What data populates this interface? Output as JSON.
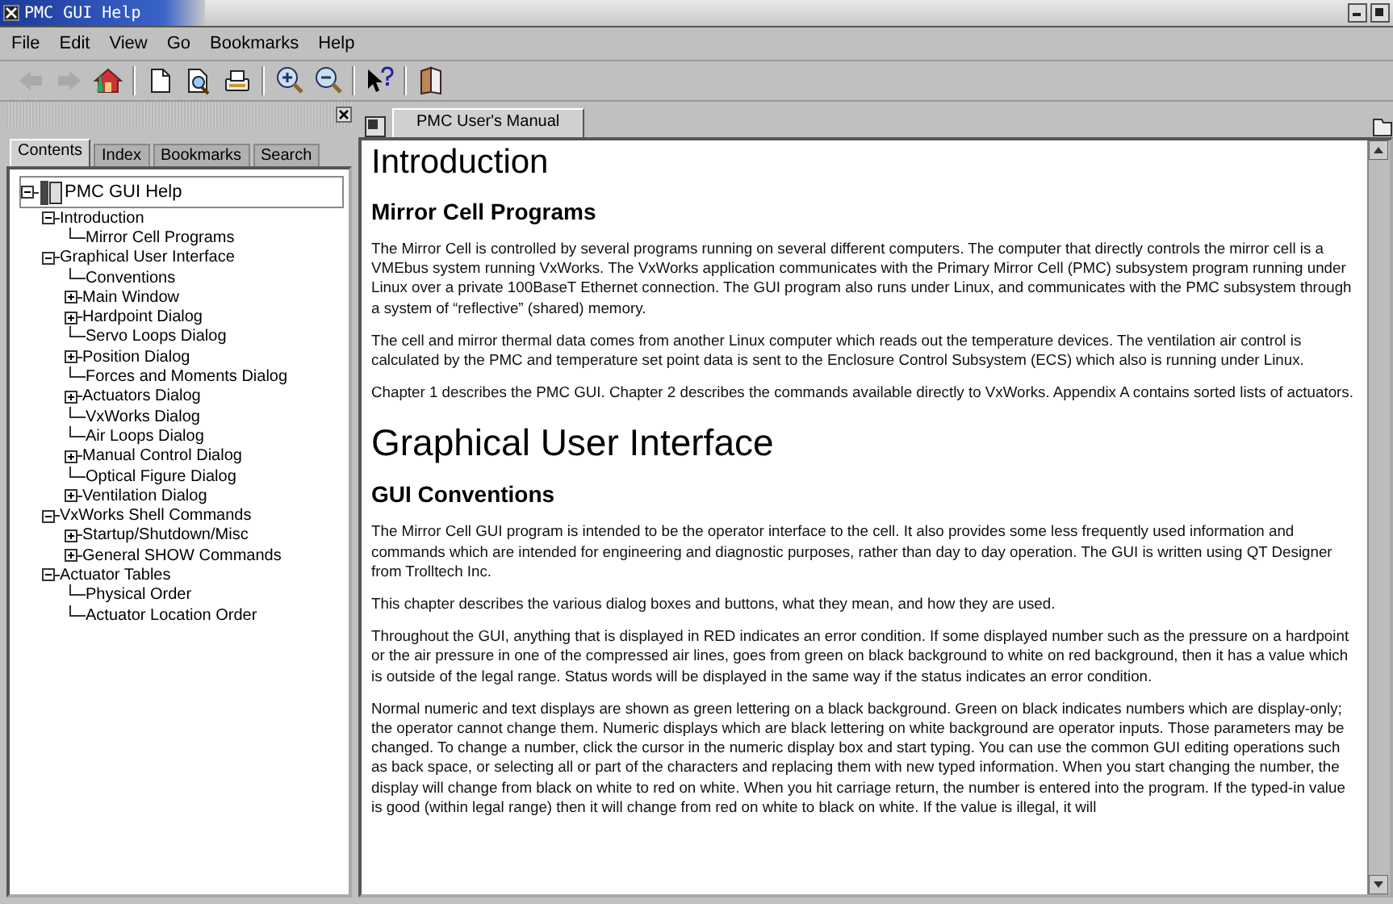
{
  "window": {
    "title": "PMC GUI Help"
  },
  "menu": [
    {
      "label": "File"
    },
    {
      "label": "Edit"
    },
    {
      "label": "View"
    },
    {
      "label": "Go"
    },
    {
      "label": "Bookmarks"
    },
    {
      "label": "Help"
    }
  ],
  "toolbar": [
    {
      "kind": "back",
      "disabled": true
    },
    {
      "kind": "forward",
      "disabled": true
    },
    {
      "kind": "home",
      "disabled": false
    },
    {
      "kind": "sep"
    },
    {
      "kind": "page",
      "disabled": false
    },
    {
      "kind": "find",
      "disabled": false
    },
    {
      "kind": "print",
      "disabled": false
    },
    {
      "kind": "sep"
    },
    {
      "kind": "zoom-in",
      "disabled": false
    },
    {
      "kind": "zoom-out",
      "disabled": false
    },
    {
      "kind": "sep"
    },
    {
      "kind": "whats-this",
      "disabled": false
    },
    {
      "kind": "sep"
    },
    {
      "kind": "book",
      "disabled": false
    }
  ],
  "sidebar": {
    "tabs": [
      {
        "label": "Contents",
        "selected": true
      },
      {
        "label": "Index",
        "selected": false
      },
      {
        "label": "Bookmarks",
        "selected": false
      },
      {
        "label": "Search",
        "selected": false
      }
    ],
    "tree": [
      {
        "label": "PMC GUI Help",
        "expanded": true,
        "children": [
          {
            "label": "Introduction",
            "expanded": true,
            "children": [
              {
                "label": "Mirror Cell Programs"
              }
            ]
          },
          {
            "label": "Graphical User Interface",
            "expanded": true,
            "children": [
              {
                "label": "Conventions"
              },
              {
                "label": "Main Window",
                "expanded": false
              },
              {
                "label": "Hardpoint Dialog",
                "expanded": false
              },
              {
                "label": "Servo Loops Dialog"
              },
              {
                "label": "Position Dialog",
                "expanded": false
              },
              {
                "label": "Forces and Moments Dialog"
              },
              {
                "label": "Actuators Dialog",
                "expanded": false
              },
              {
                "label": "VxWorks Dialog"
              },
              {
                "label": "Air Loops Dialog"
              },
              {
                "label": "Manual Control Dialog",
                "expanded": false
              },
              {
                "label": "Optical Figure Dialog"
              },
              {
                "label": "Ventilation Dialog",
                "expanded": false
              }
            ]
          },
          {
            "label": "VxWorks Shell Commands",
            "expanded": true,
            "children": [
              {
                "label": "Startup/Shutdown/Misc",
                "expanded": false
              },
              {
                "label": "General SHOW Commands",
                "expanded": false
              }
            ]
          },
          {
            "label": "Actuator Tables",
            "expanded": true,
            "children": [
              {
                "label": "Physical Order"
              },
              {
                "label": "Actuator Location Order"
              }
            ]
          }
        ]
      }
    ]
  },
  "document": {
    "tab": {
      "label": "PMC User's Manual",
      "selected": true
    },
    "blocks": [
      {
        "kind": "h1",
        "text": "Introduction"
      },
      {
        "kind": "h2",
        "text": "Mirror Cell Programs"
      },
      {
        "kind": "p",
        "text": "The Mirror Cell is controlled by several programs running on several different computers. The computer that directly controls the mirror cell is a VMEbus system running VxWorks. The VxWorks application communicates with the Primary Mirror Cell (PMC) subsystem program running under Linux over a private 100BaseT Ethernet connection. The GUI program also runs under Linux, and communicates with the PMC subsystem through a system of “reflective” (shared) memory."
      },
      {
        "kind": "p",
        "text": "The cell and mirror thermal data comes from another Linux computer which reads out the temperature devices. The ventilation air control is calculated by the PMC and temperature set point data is sent to the Enclosure Control Subsystem (ECS) which also is running under Linux."
      },
      {
        "kind": "p",
        "text": "Chapter 1 describes the PMC GUI. Chapter 2 describes the commands available directly to VxWorks. Appendix A contains sorted lists of actuators."
      },
      {
        "kind": "h1",
        "text": "Graphical User Interface"
      },
      {
        "kind": "h2",
        "text": "GUI Conventions"
      },
      {
        "kind": "p",
        "text": "The Mirror Cell GUI program is intended to be the operator interface to the cell. It also provides some less frequently used information and commands which are intended for engineering and diagnostic purposes, rather than day to day operation. The GUI is written using QT Designer from Trolltech Inc."
      },
      {
        "kind": "p",
        "text": "This chapter describes the various dialog boxes and buttons, what they mean, and how they are used."
      },
      {
        "kind": "p",
        "text": "Throughout the GUI, anything that is displayed in RED indicates an error condition. If some displayed number such as the pressure on a hardpoint or the air pressure in one of the compressed air lines, goes from green on black background to white on red background, then it has a value which is outside of the legal range. Status words will be displayed in the same way if the status indicates an error condition."
      },
      {
        "kind": "p",
        "text": "Normal numeric and text displays are shown as green lettering on a black background. Green on black indicates numbers which are display-only; the operator cannot change them. Numeric displays which are black lettering on white background are operator inputs. Those parameters may be changed. To change a number, click the cursor in the numeric display box and start typing. You can use the common GUI editing operations such as back space, or selecting all or part of the characters and replacing them with new typed information. When you start changing the number, the display will change from black on white to red on white. When you hit carriage return, the number is entered into the program. If the typed-in value is good (within legal range) then it will change from red on white to black on white. If the value is illegal, it will"
      }
    ]
  }
}
